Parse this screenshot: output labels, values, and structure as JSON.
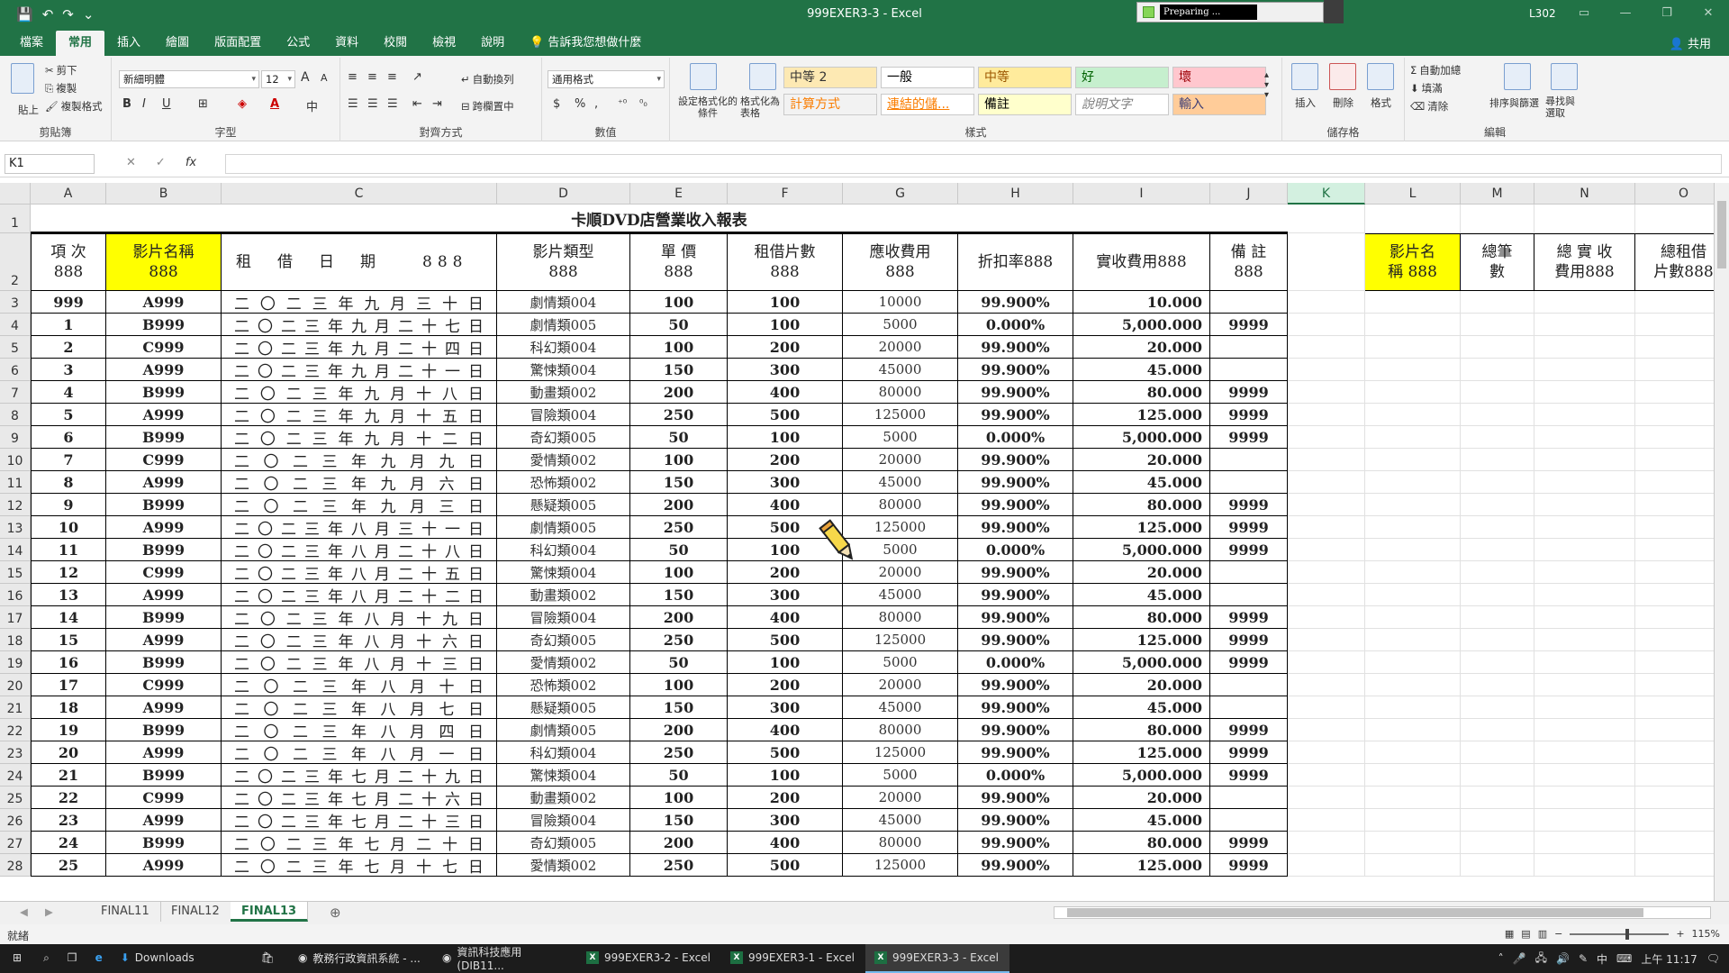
{
  "window": {
    "title": "999EXER3-3 - Excel",
    "account": "L302",
    "preparing": "Preparing ..."
  },
  "qat": {
    "save": "💾",
    "undo": "↶",
    "redo": "↷",
    "customize": "⌄"
  },
  "tabs": [
    {
      "label": "檔案"
    },
    {
      "label": "常用"
    },
    {
      "label": "插入"
    },
    {
      "label": "繪圖"
    },
    {
      "label": "版面配置"
    },
    {
      "label": "公式"
    },
    {
      "label": "資料"
    },
    {
      "label": "校閱"
    },
    {
      "label": "檢視"
    },
    {
      "label": "說明"
    },
    {
      "label": "告訴我您想做什麼"
    }
  ],
  "share": "共用",
  "ribbon": {
    "clipboard": {
      "cut": "剪下",
      "copy": "複製",
      "format_painter": "複製格式",
      "paste": "貼上",
      "label": "剪貼簿"
    },
    "font": {
      "name": "新細明體",
      "size": "12",
      "bold": "B",
      "italic": "I",
      "underline": "U",
      "label": "字型",
      "grow": "A",
      "shrink": "A",
      "color_glyph": "A"
    },
    "alignment": {
      "wrap": "自動換列",
      "merge": "跨欄置中",
      "label": "對齊方式"
    },
    "number": {
      "format": "通用格式",
      "label": "數值",
      "currency": "$",
      "percent": "%",
      "comma": ",",
      "inc": "⁺⁰",
      "dec": "⁰₀"
    },
    "styles": {
      "conditional": "設定格式化的條件",
      "as_table": "格式化為表格",
      "cells": [
        {
          "label": "中等 2",
          "bg": "#fde9b3",
          "fg": "#333333"
        },
        {
          "label": "一般",
          "bg": "#ffffff",
          "fg": "#000000"
        },
        {
          "label": "中等",
          "bg": "#ffeb9c",
          "fg": "#9c5700"
        },
        {
          "label": "好",
          "bg": "#c6efce",
          "fg": "#006100"
        },
        {
          "label": "壞",
          "bg": "#ffc7ce",
          "fg": "#9c0006"
        },
        {
          "label": "計算方式",
          "bg": "#f2f2f2",
          "fg": "#fa7d00"
        },
        {
          "label": "連結的儲...",
          "bg": "#ffffff",
          "fg": "#fa7d00"
        },
        {
          "label": "備註",
          "bg": "#ffffcc",
          "fg": "#000000"
        },
        {
          "label": "說明文字",
          "bg": "#ffffff",
          "fg": "#7f7f7f"
        },
        {
          "label": "輸入",
          "bg": "#ffcc99",
          "fg": "#3f3f76"
        }
      ],
      "label": "樣式"
    },
    "cells": {
      "insert": "插入",
      "delete": "刪除",
      "format": "格式",
      "label": "儲存格"
    },
    "editing": {
      "autosum": "自動加總",
      "fill": "填滿",
      "clear": "清除",
      "sort": "排序與篩選",
      "find": "尋找與選取",
      "label": "編輯"
    }
  },
  "formula_bar": {
    "name_box": "K1",
    "fx": "fx",
    "cancel": "✕",
    "enter": "✓"
  },
  "columns": [
    "A",
    "B",
    "C",
    "D",
    "E",
    "F",
    "G",
    "H",
    "I",
    "J",
    "K",
    "L",
    "M",
    "N",
    "O"
  ],
  "selected_column": "K",
  "sheet": {
    "title": "卡順DVD店營業收入報表",
    "headers": {
      "A": "項 次\n888",
      "B": "影片名稱\n888",
      "C": "租　借　日　期　　888",
      "D": "影片類型\n888",
      "E": "單 價\n888",
      "F": "租借片數\n888",
      "G": "應收費用\n888",
      "H": "折扣率888",
      "I": "實收費用888",
      "J": "備 註\n888",
      "L": "影片名\n稱 888",
      "M": "總筆\n數",
      "N": "總 實 收\n費用888",
      "O": "總租借\n片數888"
    },
    "rows": [
      [
        "999",
        "A999",
        "二〇二三年九月三十日",
        "劇情類004",
        "100",
        "100",
        "10000",
        "99.900%",
        "10.000",
        ""
      ],
      [
        "1",
        "B999",
        "二〇二三年九月二十七日",
        "劇情類005",
        "50",
        "100",
        "5000",
        "0.000%",
        "5,000.000",
        "9999"
      ],
      [
        "2",
        "C999",
        "二〇二三年九月二十四日",
        "科幻類004",
        "100",
        "200",
        "20000",
        "99.900%",
        "20.000",
        ""
      ],
      [
        "3",
        "A999",
        "二〇二三年九月二十一日",
        "驚悚類004",
        "150",
        "300",
        "45000",
        "99.900%",
        "45.000",
        ""
      ],
      [
        "4",
        "B999",
        "二〇二三年九月十八日",
        "動畫類002",
        "200",
        "400",
        "80000",
        "99.900%",
        "80.000",
        "9999"
      ],
      [
        "5",
        "A999",
        "二〇二三年九月十五日",
        "冒險類004",
        "250",
        "500",
        "125000",
        "99.900%",
        "125.000",
        "9999"
      ],
      [
        "6",
        "B999",
        "二〇二三年九月十二日",
        "奇幻類005",
        "50",
        "100",
        "5000",
        "0.000%",
        "5,000.000",
        "9999"
      ],
      [
        "7",
        "C999",
        "二〇二三年九月九日",
        "愛情類002",
        "100",
        "200",
        "20000",
        "99.900%",
        "20.000",
        ""
      ],
      [
        "8",
        "A999",
        "二〇二三年九月六日",
        "恐怖類002",
        "150",
        "300",
        "45000",
        "99.900%",
        "45.000",
        ""
      ],
      [
        "9",
        "B999",
        "二〇二三年九月三日",
        "懸疑類005",
        "200",
        "400",
        "80000",
        "99.900%",
        "80.000",
        "9999"
      ],
      [
        "10",
        "A999",
        "二〇二三年八月三十一日",
        "劇情類005",
        "250",
        "500",
        "125000",
        "99.900%",
        "125.000",
        "9999"
      ],
      [
        "11",
        "B999",
        "二〇二三年八月二十八日",
        "科幻類004",
        "50",
        "100",
        "5000",
        "0.000%",
        "5,000.000",
        "9999"
      ],
      [
        "12",
        "C999",
        "二〇二三年八月二十五日",
        "驚悚類004",
        "100",
        "200",
        "20000",
        "99.900%",
        "20.000",
        ""
      ],
      [
        "13",
        "A999",
        "二〇二三年八月二十二日",
        "動畫類002",
        "150",
        "300",
        "45000",
        "99.900%",
        "45.000",
        ""
      ],
      [
        "14",
        "B999",
        "二〇二三年八月十九日",
        "冒險類004",
        "200",
        "400",
        "80000",
        "99.900%",
        "80.000",
        "9999"
      ],
      [
        "15",
        "A999",
        "二〇二三年八月十六日",
        "奇幻類005",
        "250",
        "500",
        "125000",
        "99.900%",
        "125.000",
        "9999"
      ],
      [
        "16",
        "B999",
        "二〇二三年八月十三日",
        "愛情類002",
        "50",
        "100",
        "5000",
        "0.000%",
        "5,000.000",
        "9999"
      ],
      [
        "17",
        "C999",
        "二〇二三年八月十日",
        "恐怖類002",
        "100",
        "200",
        "20000",
        "99.900%",
        "20.000",
        ""
      ],
      [
        "18",
        "A999",
        "二〇二三年八月七日",
        "懸疑類005",
        "150",
        "300",
        "45000",
        "99.900%",
        "45.000",
        ""
      ],
      [
        "19",
        "B999",
        "二〇二三年八月四日",
        "劇情類005",
        "200",
        "400",
        "80000",
        "99.900%",
        "80.000",
        "9999"
      ],
      [
        "20",
        "A999",
        "二〇二三年八月一日",
        "科幻類004",
        "250",
        "500",
        "125000",
        "99.900%",
        "125.000",
        "9999"
      ],
      [
        "21",
        "B999",
        "二〇二三年七月二十九日",
        "驚悚類004",
        "50",
        "100",
        "5000",
        "0.000%",
        "5,000.000",
        "9999"
      ],
      [
        "22",
        "C999",
        "二〇二三年七月二十六日",
        "動畫類002",
        "100",
        "200",
        "20000",
        "99.900%",
        "20.000",
        ""
      ],
      [
        "23",
        "A999",
        "二〇二三年七月二十三日",
        "冒險類004",
        "150",
        "300",
        "45000",
        "99.900%",
        "45.000",
        ""
      ],
      [
        "24",
        "B999",
        "二〇二三年七月二十日",
        "奇幻類005",
        "200",
        "400",
        "80000",
        "99.900%",
        "80.000",
        "9999"
      ],
      [
        "25",
        "A999",
        "二〇二三年七月十七日",
        "愛情類002",
        "250",
        "500",
        "125000",
        "99.900%",
        "125.000",
        "9999"
      ]
    ]
  },
  "sheet_tabs": [
    {
      "label": "FINAL11"
    },
    {
      "label": "FINAL12"
    },
    {
      "label": "FINAL13"
    }
  ],
  "active_sheet": "FINAL13",
  "status": {
    "ready": "就緒",
    "zoom": "115%"
  },
  "taskbar": {
    "items": [
      {
        "label": "Downloads"
      },
      {
        "label": "教務行政資訊系統 - ..."
      },
      {
        "label": "資訊科技應用 (DIB11..."
      },
      {
        "label": "999EXER3-2 - Excel"
      },
      {
        "label": "999EXER3-1 - Excel"
      },
      {
        "label": "999EXER3-3 - Excel"
      }
    ],
    "ime": "中",
    "clock": "上午 11:17"
  },
  "colors": {
    "accent": "#217346",
    "highlight": "#ffff00"
  }
}
